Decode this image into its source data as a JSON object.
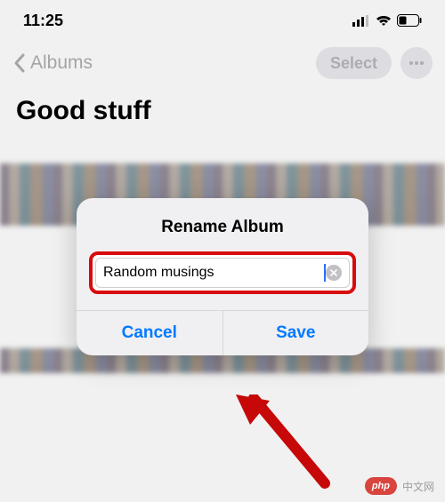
{
  "status": {
    "time": "11:25"
  },
  "nav": {
    "back_label": "Albums",
    "select_label": "Select"
  },
  "album": {
    "title": "Good stuff"
  },
  "alert": {
    "title": "Rename Album",
    "input_value": "Random musings",
    "cancel_label": "Cancel",
    "save_label": "Save"
  },
  "watermark": {
    "brand": "php",
    "site": "中文网"
  },
  "colors": {
    "ios_blue": "#007aff",
    "highlight_red": "#d80c0c",
    "disabled_gray": "#aeaeb2"
  }
}
